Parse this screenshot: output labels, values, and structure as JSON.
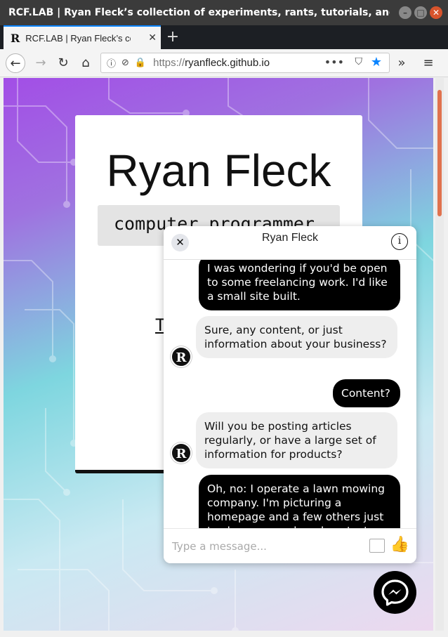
{
  "window": {
    "title": "RCF.LAB | Ryan Fleck’s collection of experiments, rants, tutorials, and thou...",
    "buttons": {
      "minimize": "–",
      "maximize": "□",
      "close": "✕"
    }
  },
  "tabs": [
    {
      "label": "RCF.LAB | Ryan Fleck’s col",
      "favicon": "R",
      "close": "✕"
    }
  ],
  "new_tab_label": "+",
  "navbar": {
    "back": "←",
    "forward": "→",
    "reload": "↻",
    "home": "⌂",
    "url_scheme": "https://",
    "url_host": "ryanfleck.github.io",
    "page_actions": "•••",
    "overflow": "»",
    "menu": "≡"
  },
  "page": {
    "name": "Ryan Fleck",
    "subtitle": "computer programmer",
    "link_fragment": "T"
  },
  "chat": {
    "title": "Ryan Fleck",
    "close": "✕",
    "info": "i",
    "avatar_letter": "R",
    "messages": [
      {
        "from": "me",
        "text": "I was wondering if you'd be open to some freelancing work. I'd like a small site built."
      },
      {
        "from": "them",
        "text": "Sure, any content, or just information about your business?"
      },
      {
        "from": "me",
        "text": "Content?"
      },
      {
        "from": "them",
        "text": "Will you be posting articles regularly, or have a large set of information for products?"
      },
      {
        "from": "me",
        "text": "Oh, no: I operate a lawn mowing company. I'm picturing a homepage and a few others just to show my work and contact info."
      }
    ],
    "composer_placeholder": "Type a message...",
    "thumb": "👍"
  },
  "colors": {
    "accent": "#0a84ff",
    "lock": "#12bc00",
    "scroll_thumb": "#e0724e",
    "bubble_me": "#000000",
    "bubble_them": "#eeeeee"
  }
}
